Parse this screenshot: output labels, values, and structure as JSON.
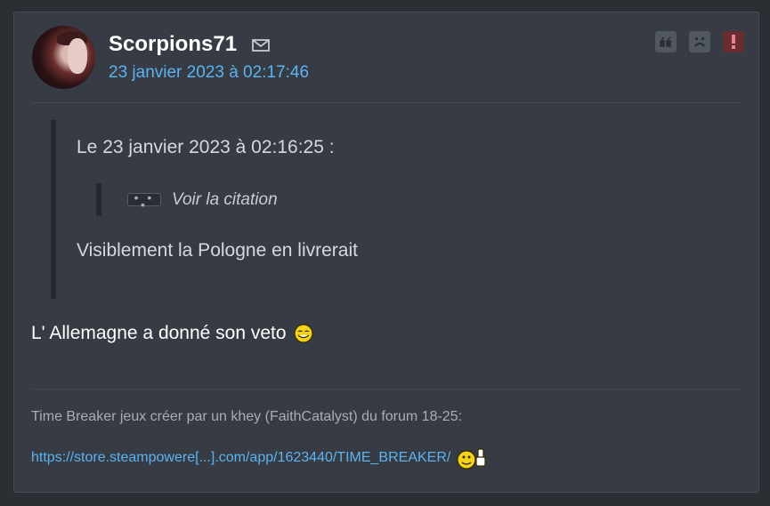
{
  "post": {
    "author": "Scorpions71",
    "date": "23 janvier 2023 à 02:17:46",
    "actions": [
      {
        "name": "quote-icon"
      },
      {
        "name": "sad-face-icon"
      },
      {
        "name": "report-icon",
        "color": "#6a2b31"
      }
    ],
    "quote": {
      "header": "Le 23 janvier 2023 à 02:16:25 :",
      "nested_expander": "• • •",
      "nested_label": "Voir la citation",
      "text": "Visiblement la Pologne en livrerait"
    },
    "message": "L' Allemagne a donné son veto",
    "signature": {
      "text": "Time Breaker jeux créer par un khey (FaithCatalyst) du forum 18-25:",
      "link": "https://store.steampowere[...].com/app/1623440/TIME_BREAKER/"
    }
  },
  "colors": {
    "background": "#2b2e33",
    "card": "#363b44",
    "accent": "#5cb3f0",
    "report": "#6a2b31"
  }
}
